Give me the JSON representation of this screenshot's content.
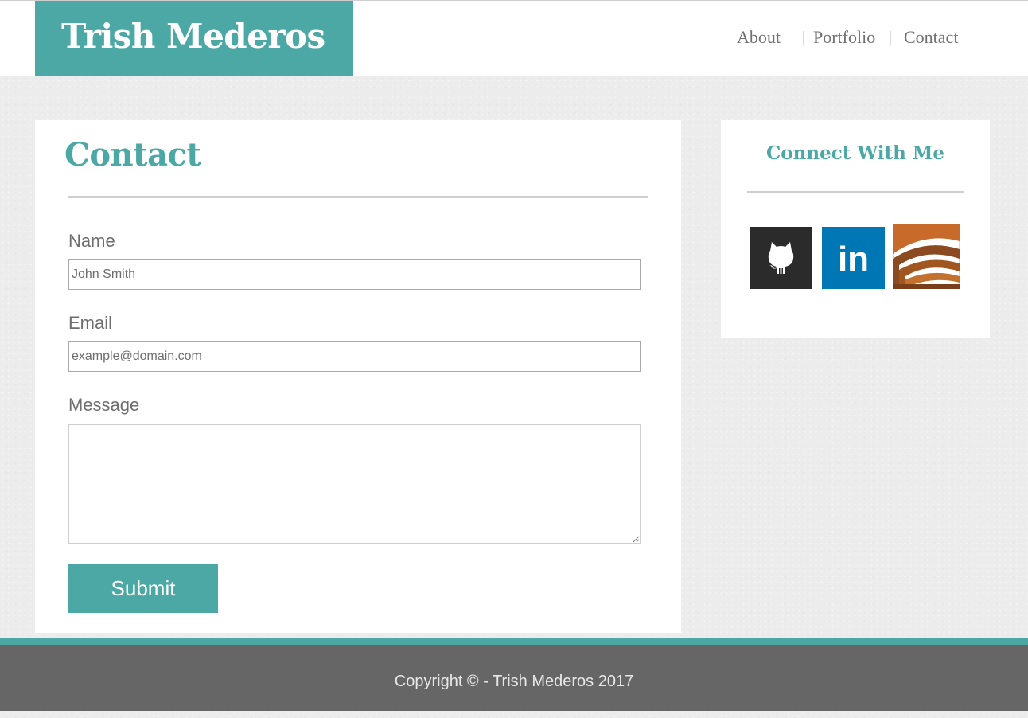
{
  "header": {
    "brand": "Trish Mederos",
    "nav": [
      {
        "label": "About"
      },
      {
        "label": "Portfolio"
      },
      {
        "label": "Contact"
      }
    ],
    "separator": "|"
  },
  "contact": {
    "title": "Contact",
    "fields": {
      "name": {
        "label": "Name",
        "placeholder": "John Smith"
      },
      "email": {
        "label": "Email",
        "placeholder": "example@domain.com"
      },
      "message": {
        "label": "Message",
        "placeholder": ""
      }
    },
    "submit_label": "Submit"
  },
  "sidebar": {
    "title": "Connect With Me",
    "social": [
      {
        "icon": "github-icon",
        "color": "#2b2b2b"
      },
      {
        "icon": "linkedin-icon",
        "color": "#0077b5",
        "glyph": "in"
      },
      {
        "icon": "stackoverflow-icon",
        "color": "#b5612a"
      }
    ]
  },
  "footer": {
    "text": "Copyright © - Trish Mederos 2017"
  },
  "colors": {
    "accent": "#4ba8a4",
    "footer_bg": "#666666",
    "text_gray": "#707070"
  }
}
